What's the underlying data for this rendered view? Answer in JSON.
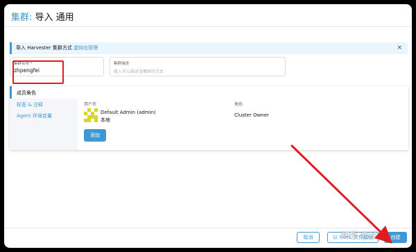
{
  "header": {
    "title_cluster": "集群:",
    "title_rest": " 导入 通用"
  },
  "banner": {
    "text": "导入 Harvester 集群方式",
    "link": "虚拟化管理",
    "close": "×"
  },
  "form": {
    "name_label": "集群名称",
    "name_required": "*",
    "name_value": "zhpengfei",
    "desc_label": "集群描述",
    "desc_placeholder": "输入可以描述该集群的文本"
  },
  "tabs": [
    "成员角色",
    "标签 & 注释",
    "Agent 环境变量"
  ],
  "members": {
    "col_user": "用户名",
    "col_role": "角色",
    "user_name": "Default Admin (admin)",
    "user_source": "本地",
    "role": "Cluster Owner",
    "add_button": "添加"
  },
  "footer": {
    "cancel": "取消",
    "edit_yaml": "以 YAML 文件编辑",
    "create": "创建"
  },
  "watermark": "知乎 @谷溪",
  "colors": {
    "accent": "#3d98d3",
    "highlight": "#e11b22",
    "avatar": "#d8d62e"
  }
}
